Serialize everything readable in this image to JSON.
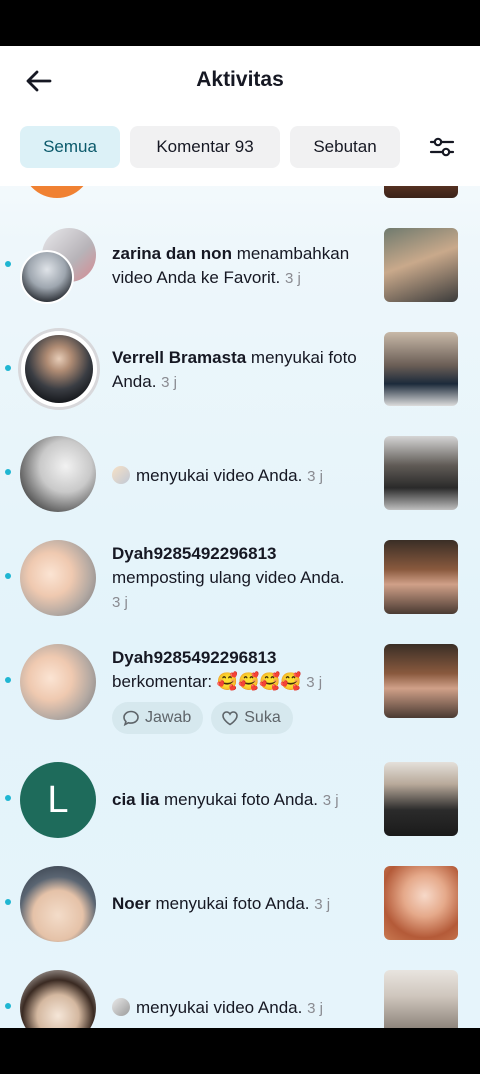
{
  "header": {
    "title": "Aktivitas"
  },
  "tabs": [
    {
      "label": "Semua",
      "active": true
    },
    {
      "label": "Komentar 93",
      "active": false
    },
    {
      "label": "Sebutan",
      "active": false
    }
  ],
  "icons": {
    "back": "back-arrow-icon",
    "filter": "filter-sliders-icon"
  },
  "colors": {
    "accent": "#1fb6d2",
    "active_tab_bg": "#dcf1f7",
    "active_tab_text": "#0b5a6b"
  },
  "items": [
    {
      "user": "zarina dan non",
      "action": " menambahkan video Anda ke Favorit.",
      "time": "3 j"
    },
    {
      "user": "Verrell Bramasta",
      "action": " menyukai foto Anda.",
      "time": "3 j"
    },
    {
      "user": "",
      "action": "menyukai video Anda.",
      "time": "3 j"
    },
    {
      "user": "Dyah9285492296813",
      "action": "memposting ulang video Anda.",
      "time": "3 j"
    },
    {
      "user": "Dyah9285492296813",
      "action": "berkomentar: 🥰🥰🥰🥰",
      "time": "3 j"
    },
    {
      "user": "cia lia",
      "action": " menyukai foto Anda.",
      "time": "3 j",
      "avatar_letter": "L"
    },
    {
      "user": "Noer",
      "action": " menyukai foto Anda.",
      "time": "3 j"
    },
    {
      "user": "",
      "action": "menyukai video Anda.",
      "time": "3 j"
    }
  ],
  "comment_actions": {
    "reply": "Jawab",
    "like": "Suka"
  }
}
